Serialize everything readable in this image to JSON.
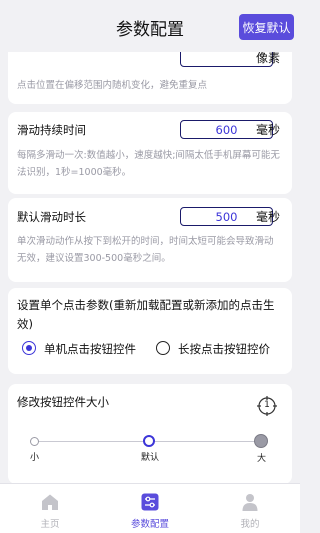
{
  "header": {
    "title": "参数配置",
    "reset_label": "恢复默认"
  },
  "top_partial": {
    "unit": "像素",
    "desc": "点击位置在偏移范围内随机变化，避免重复点"
  },
  "swipe_duration": {
    "label": "滑动持续时间",
    "value": "600",
    "unit": "毫秒",
    "desc": "每隔多滑动一次:数值越小，速度越快;间隔太低手机屏幕可能无法识别，1秒=1000毫秒。"
  },
  "default_swipe": {
    "label": "默认滑动时长",
    "value": "500",
    "unit": "毫秒",
    "desc": "单次滑动动作从按下到松开的时间，时间太短可能会导致滑动无效，建议设置300-500毫秒之间。"
  },
  "click_param": {
    "label": "设置单个点击参数(重新加载配置或新添加的点击生效)",
    "options": [
      {
        "label": "单机点击按钮控件",
        "selected": true
      },
      {
        "label": "长按点击按钮控价",
        "selected": false
      }
    ]
  },
  "button_size": {
    "label": "修改按钮控件大小",
    "preview": "1",
    "ticks": [
      "小",
      "默认",
      "大"
    ],
    "selected_index": 1
  },
  "tabbar": {
    "tabs": [
      {
        "label": "主页",
        "icon": "home-icon",
        "active": false
      },
      {
        "label": "参数配置",
        "icon": "sliders-icon",
        "active": true
      },
      {
        "label": "我的",
        "icon": "user-icon",
        "active": false
      }
    ]
  },
  "colors": {
    "accent": "#5a4cdc",
    "value_text": "#3c35d8",
    "box_border": "#1a1a6a",
    "inactive_tab": "#b2b2b8"
  }
}
